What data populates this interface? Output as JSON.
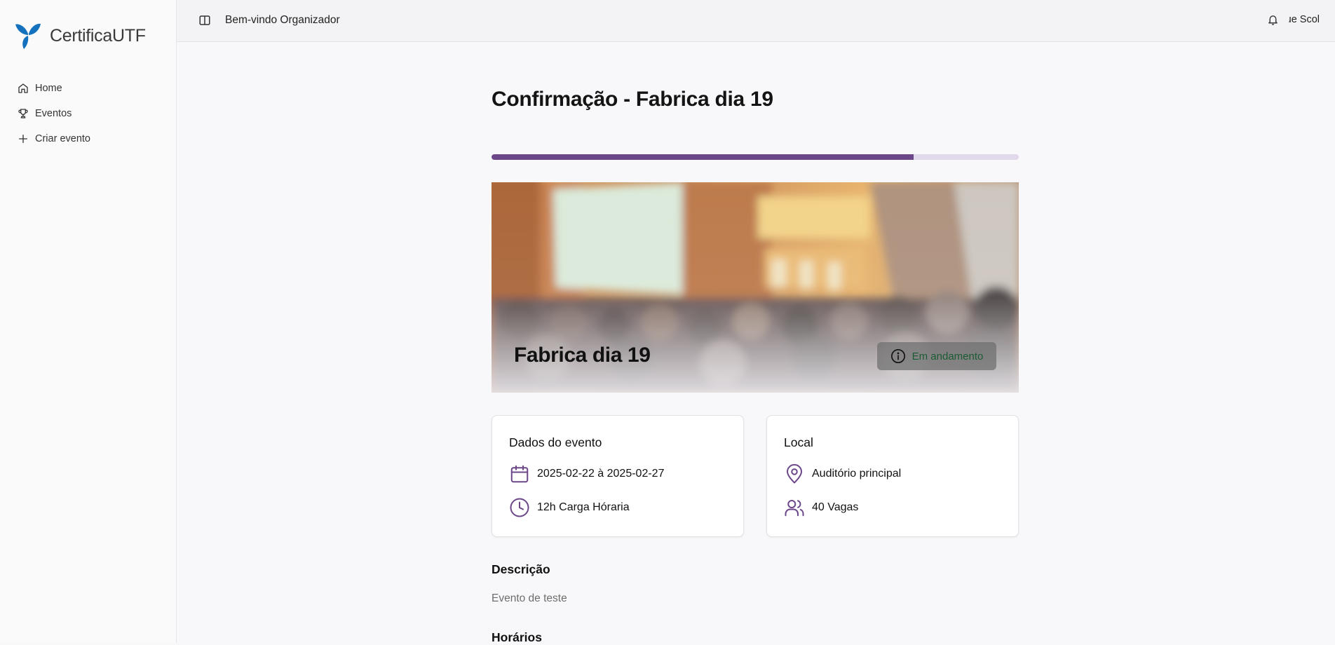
{
  "app": {
    "name": "CertificaUTF",
    "brand_color": "#1471bd"
  },
  "sidebar": {
    "items": [
      {
        "label": "Home",
        "icon": "home-icon"
      },
      {
        "label": "Eventos",
        "icon": "trophy-icon"
      },
      {
        "label": "Criar evento",
        "icon": "plus-icon"
      }
    ]
  },
  "topbar": {
    "welcome": "Bem-vindo Organizador",
    "user_name": "ue Scol"
  },
  "page": {
    "title": "Confirmação - Fabrica dia 19"
  },
  "progress": {
    "value": 0.8,
    "color": "#6b4689"
  },
  "hero": {
    "event_name": "Fabrica dia 19",
    "status": "Em andamento"
  },
  "event_card": {
    "title": "Dados do evento",
    "dates": "2025-02-22 à 2025-02-27",
    "workload": "12h Carga Hóraria"
  },
  "location_card": {
    "title": "Local",
    "place": "Auditório principal",
    "spots": "40 Vagas"
  },
  "description": {
    "label": "Descrição",
    "text": "Evento de teste"
  },
  "schedule": {
    "label": "Horários"
  },
  "accent_color": "#6b4689"
}
